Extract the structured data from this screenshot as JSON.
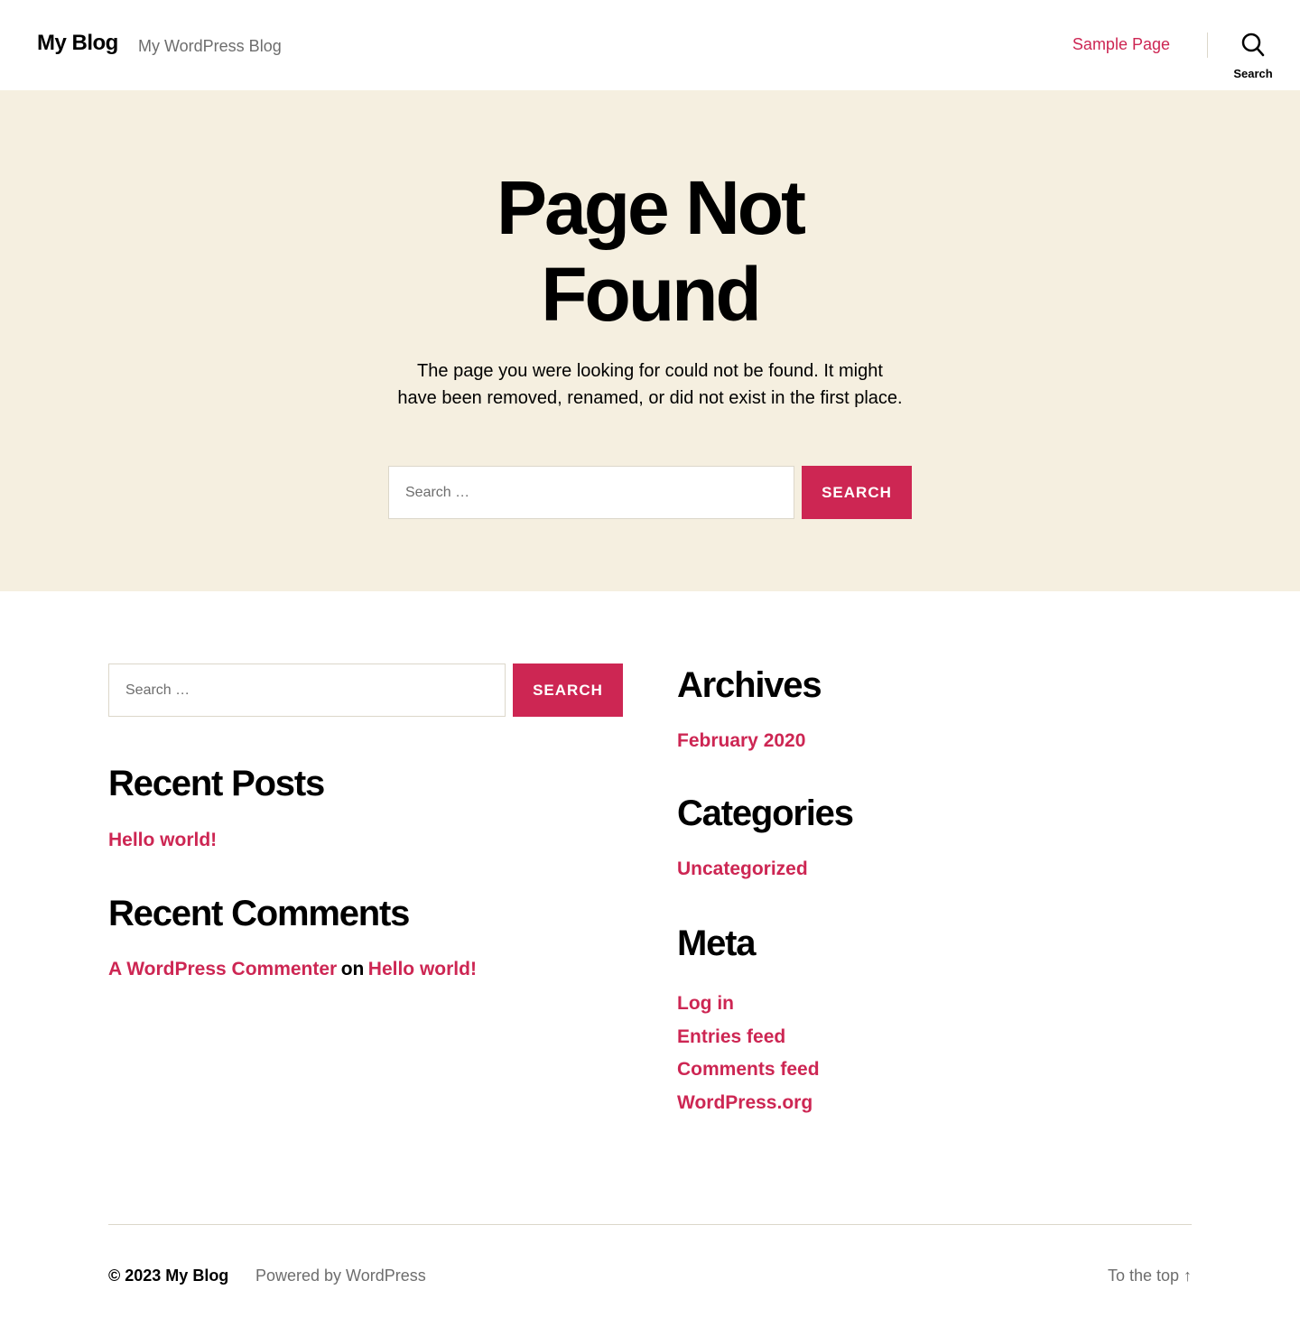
{
  "header": {
    "site_title": "My Blog",
    "site_description": "My WordPress Blog",
    "nav_link": "Sample Page",
    "search_toggle_label": "Search"
  },
  "hero": {
    "title": "Page Not Found",
    "text": "The page you were looking for could not be found. It might have been removed, renamed, or did not exist in the first place.",
    "search_placeholder": "Search …",
    "search_button": "Search"
  },
  "widgets": {
    "search_placeholder": "Search …",
    "search_button": "Search",
    "recent_posts_title": "Recent Posts",
    "recent_posts": [
      "Hello world!"
    ],
    "recent_comments_title": "Recent Comments",
    "recent_comment": {
      "author": "A WordPress Commenter",
      "on": "on",
      "post": "Hello world!"
    },
    "archives_title": "Archives",
    "archives": [
      "February 2020"
    ],
    "categories_title": "Categories",
    "categories": [
      "Uncategorized"
    ],
    "meta_title": "Meta",
    "meta_links": [
      "Log in",
      "Entries feed",
      "Comments feed",
      "WordPress.org"
    ]
  },
  "footer": {
    "copyright": "© 2023 My Blog",
    "powered_by": "Powered by WordPress",
    "to_top": "To the top ↑"
  },
  "colors": {
    "accent": "#cd2653",
    "hero_bg": "#f5efe0",
    "muted_text": "#6d6d6d",
    "border": "#dcd7ca"
  }
}
